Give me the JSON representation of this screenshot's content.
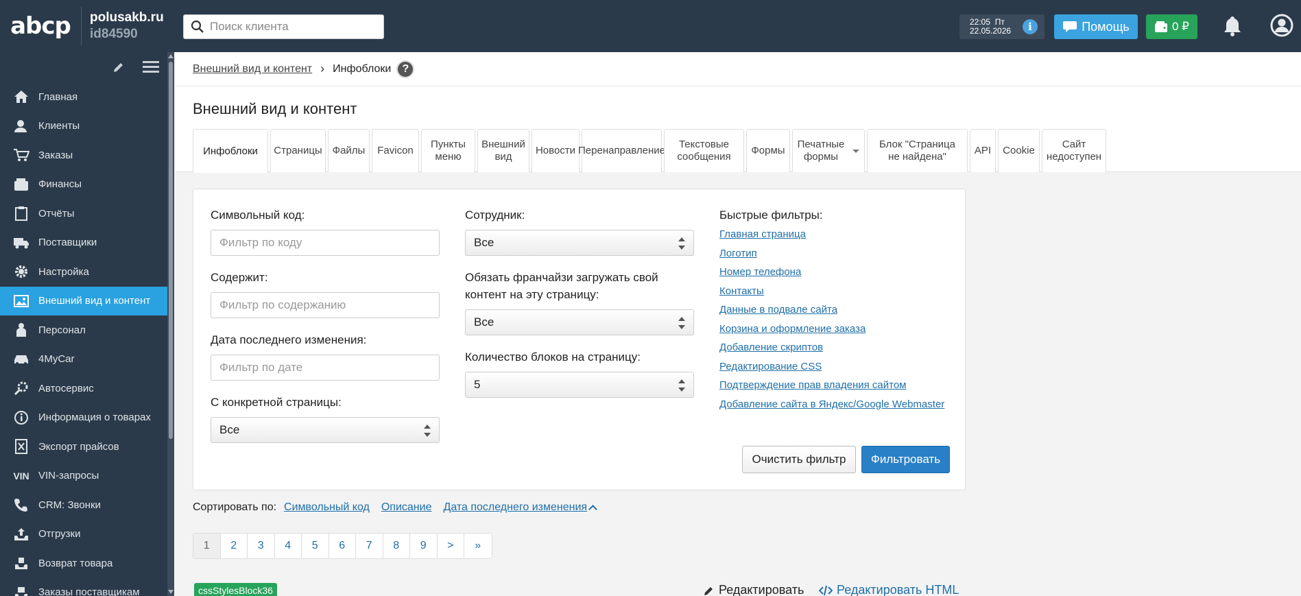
{
  "topbar": {
    "logo": "abcp",
    "domain": "polusakb.ru",
    "account_id": "id84590",
    "search_placeholder": "Поиск клиента",
    "time": "22:05",
    "weekday": "Пт",
    "date": "22.05.2026",
    "help_label": "Помощь",
    "balance": "0 ₽"
  },
  "sidebar": {
    "items": [
      {
        "label": "Главная",
        "icon": "home-icon"
      },
      {
        "label": "Клиенты",
        "icon": "clients-icon"
      },
      {
        "label": "Заказы",
        "icon": "cart-icon"
      },
      {
        "label": "Финансы",
        "icon": "wallet-icon"
      },
      {
        "label": "Отчёты",
        "icon": "clipboard-icon"
      },
      {
        "label": "Поставщики",
        "icon": "truck-icon"
      },
      {
        "label": "Настройка",
        "icon": "gear-icon"
      },
      {
        "label": "Внешний вид и контент",
        "icon": "image-icon",
        "active": true
      },
      {
        "label": "Персонал",
        "icon": "staff-icon"
      },
      {
        "label": "4MyCar",
        "icon": "car-icon"
      },
      {
        "label": "Автосервис",
        "icon": "service-icon"
      },
      {
        "label": "Информация о товарах",
        "icon": "info-icon"
      },
      {
        "label": "Экспорт прайсов",
        "icon": "excel-icon"
      },
      {
        "label": "VIN-запросы",
        "icon": "vin-icon"
      },
      {
        "label": "CRM: Звонки",
        "icon": "phone-icon"
      },
      {
        "label": "Отгрузки",
        "icon": "shipment-icon"
      },
      {
        "label": "Возврат товара",
        "icon": "return-icon"
      },
      {
        "label": "Заказы поставщикам",
        "icon": "supplier-orders-icon"
      }
    ]
  },
  "breadcrumb": {
    "parent": "Внешний вид и контент",
    "current": "Инфоблоки",
    "help": "?"
  },
  "page_title": "Внешний вид и контент",
  "tabs": [
    {
      "label": "Инфоблоки",
      "active": true
    },
    {
      "label": "Страницы"
    },
    {
      "label": "Файлы"
    },
    {
      "label": "Favicon"
    },
    {
      "label": "Пункты меню"
    },
    {
      "label": "Внешний вид"
    },
    {
      "label": "Новости"
    },
    {
      "label": "Перенаправление"
    },
    {
      "label": "Текстовые сообщения"
    },
    {
      "label": "Формы"
    },
    {
      "label": "Печатные формы",
      "dropdown": true
    },
    {
      "label": "Блок \"Страница не найдена\""
    },
    {
      "label": "API"
    },
    {
      "label": "Cookie"
    },
    {
      "label": "Сайт недоступен"
    }
  ],
  "filters": {
    "code_label": "Символьный код:",
    "code_placeholder": "Фильтр по коду",
    "contains_label": "Содержит:",
    "contains_placeholder": "Фильтр по содержанию",
    "date_label": "Дата последнего изменения:",
    "date_placeholder": "Фильтр по дате",
    "page_label": "С конкретной страницы:",
    "page_value": "Все",
    "employee_label": "Сотрудник:",
    "employee_value": "Все",
    "franchise_label": "Обязать франчайзи загружать свой контент на эту страницу:",
    "franchise_value": "Все",
    "count_label": "Количество блоков на страницу:",
    "count_value": "5",
    "quick_label": "Быстрые фильтры:",
    "quick_links": [
      "Главная страница",
      "Логотип",
      "Номер телефона",
      "Контакты",
      "Данные в подвале сайта",
      "Корзина и оформление заказа",
      "Добавление скриптов",
      "Редактирование CSS",
      "Подтверждение прав владения сайтом",
      "Добавление сайта в Яндекс/Google Webmaster"
    ],
    "clear_label": "Очистить фильтр",
    "apply_label": "Фильтровать"
  },
  "sort": {
    "label": "Сортировать по:",
    "options": [
      "Символьный код",
      "Описание",
      "Дата последнего изменения"
    ]
  },
  "pagination": [
    "1",
    "2",
    "3",
    "4",
    "5",
    "6",
    "7",
    "8",
    "9",
    ">",
    "»"
  ],
  "block": {
    "tag": "cssStylesBlock36",
    "edit_label": "Редактировать",
    "edit_html_label": "Редактировать HTML"
  }
}
